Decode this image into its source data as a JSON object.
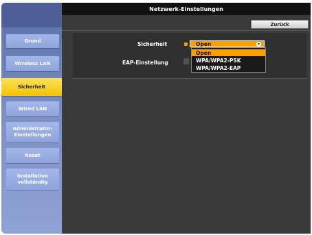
{
  "window": {
    "title": "Netzwerk-Einstellungen"
  },
  "toolbar": {
    "back_label": "Zurück"
  },
  "sidebar": {
    "items": [
      {
        "label": "Grund",
        "active": false
      },
      {
        "label": "Wireless LAN",
        "active": false
      },
      {
        "label": "Sicherheit",
        "active": true
      },
      {
        "label": "Wired LAN",
        "active": false
      },
      {
        "label": "Administrator-Einstellungen",
        "active": false
      },
      {
        "label": "Reset",
        "active": false
      },
      {
        "label": "Installation vollständig",
        "active": false
      }
    ]
  },
  "settings": {
    "security_label": "Sicherheit",
    "security_value": "Open",
    "eap_label": "EAP-Einstellung"
  },
  "dropdown": {
    "options": [
      "Open",
      "WPA/WPA2-PSK",
      "WPA/WPA2-EAP"
    ],
    "highlighted": "Open"
  },
  "colors": {
    "accent": "#ff9f00",
    "active_tab": "#f2c300",
    "sidebar_button": "#8ea3da",
    "panel": "#3a3a3a"
  },
  "icons": {
    "dropdown": "chevron-down-icon"
  }
}
